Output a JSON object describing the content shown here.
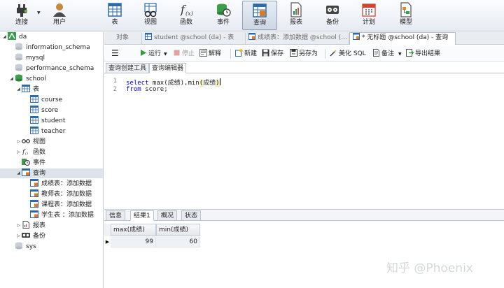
{
  "toolbar": {
    "connect": {
      "label": "连接",
      "icon": "plug-icon"
    },
    "user": {
      "label": "用户",
      "icon": "user-icon"
    },
    "table": {
      "label": "表",
      "icon": "table-icon"
    },
    "view": {
      "label": "视图",
      "icon": "glasses-icon"
    },
    "function": {
      "label": "函数",
      "icon": "function-icon"
    },
    "event": {
      "label": "事件",
      "icon": "clock-icon"
    },
    "query": {
      "label": "查询",
      "icon": "query-icon"
    },
    "report": {
      "label": "报表",
      "icon": "report-icon"
    },
    "backup": {
      "label": "备份",
      "icon": "backup-icon"
    },
    "schedule": {
      "label": "计划",
      "icon": "calendar-icon"
    },
    "model": {
      "label": "模型",
      "icon": "model-icon"
    }
  },
  "sidebar": {
    "connection": "da",
    "databases": [
      "information_schema",
      "mysql",
      "performance_schema"
    ],
    "school": {
      "name": "school",
      "tables_label": "表",
      "tables": [
        "course",
        "score",
        "student",
        "teacher"
      ],
      "views_label": "视图",
      "functions_label": "函数",
      "events_label": "事件",
      "queries_label": "查询",
      "queries": [
        "成绩表：添加数据",
        "教师表：添加数据",
        "课程表：添加数据",
        "学生表 ：添加数据"
      ],
      "reports_label": "报表",
      "backups_label": "备份"
    },
    "sys": "sys"
  },
  "doc_tabs": [
    "对象",
    "student @school (da) - 表",
    "成绩表：添加数据 @school (…",
    "* 无标题 @school (da) - 查询"
  ],
  "query_toolbar": {
    "run": "运行",
    "stop": "停止",
    "explain": "解释",
    "new": "新建",
    "save": "保存",
    "save_as": "另存为",
    "beautify": "美化 SQL",
    "comment": "备注",
    "export": "导出结果"
  },
  "subtabs": [
    "查询创建工具",
    "查询编辑器"
  ],
  "editor": {
    "line_numbers": [
      "1",
      "2"
    ],
    "line1": {
      "kw": "select",
      "mid": " max(成绩),min",
      "paren_open": "(",
      "arg": "成绩",
      "paren_close": ")"
    },
    "line2": {
      "kw": "from",
      "rest": " score;"
    }
  },
  "result_tabs": [
    "信息",
    "结果1",
    "概况",
    "状态"
  ],
  "result": {
    "columns": [
      "max(成绩)",
      "min(成绩)"
    ],
    "rows": [
      [
        "99",
        "60"
      ]
    ],
    "row_marker": "▶"
  },
  "watermark": "知乎 @Phoenix"
}
